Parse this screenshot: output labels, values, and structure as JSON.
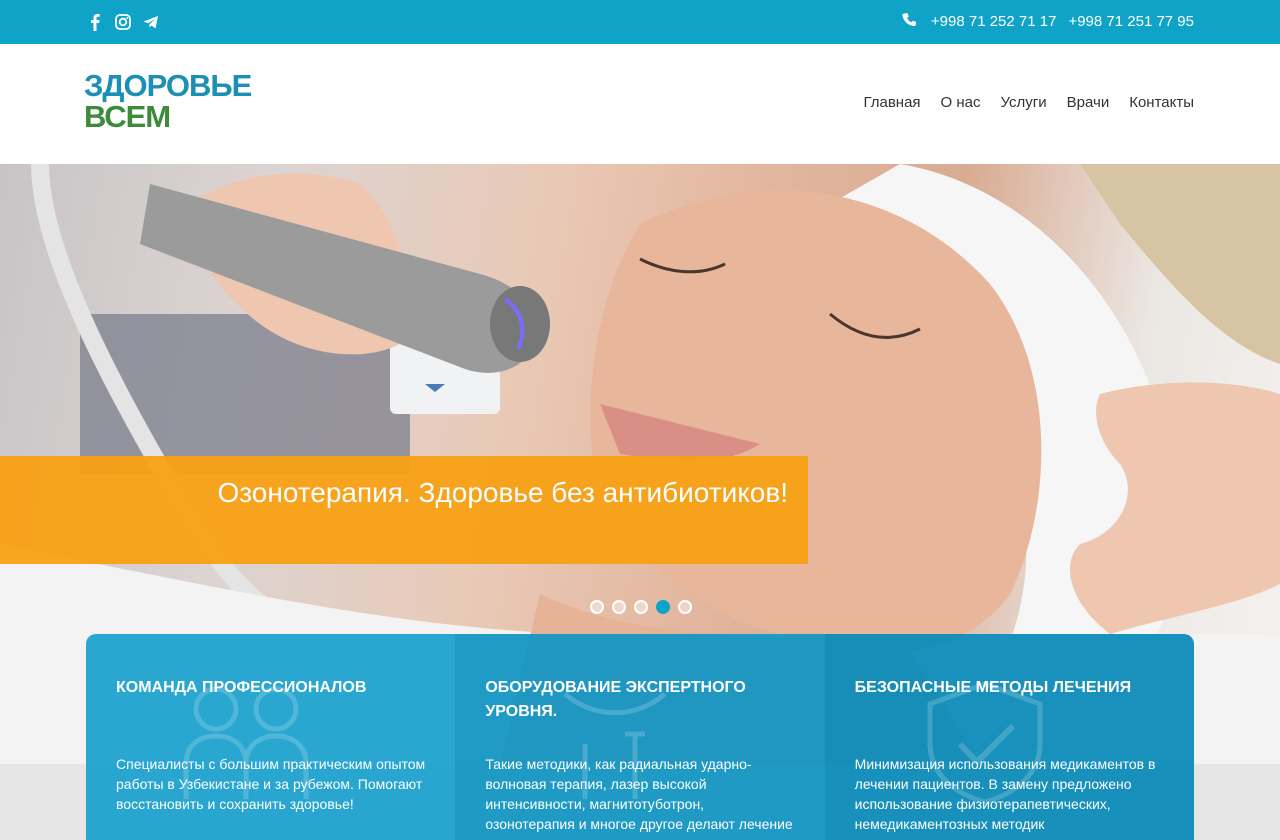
{
  "topbar": {
    "social": [
      {
        "icon": "facebook-icon"
      },
      {
        "icon": "instagram-icon"
      },
      {
        "icon": "telegram-icon"
      }
    ],
    "phone_icon": "phone-icon",
    "phone1": "+998 71 252 71 17",
    "phone2": "+998 71 251 77 95",
    "color": "#0ea3c7"
  },
  "logo": {
    "line1": "ЗДОРОВЬЕ",
    "line2": "ВСЕМ",
    "color1": "#1c90b4",
    "color2": "#3c8b3b"
  },
  "nav": {
    "items": [
      "Главная",
      "О нас",
      "Услуги",
      "Врачи",
      "Контакты"
    ]
  },
  "hero": {
    "banner_text": "Озонотерапия. Здоровье без антибиотиков!",
    "banner_color": "#f8a014",
    "slides_total": 5,
    "active_slide": 4
  },
  "features": [
    {
      "title": "КОМАНДА ПРОФЕССИОНАЛОВ",
      "text": "Специалисты с большим практическим опытом работы в Узбекистане и за рубежом. Помогают восстановить и сохранить здоровье!",
      "icon": "doctors-team-icon"
    },
    {
      "title": "ОБОРУДОВАНИЕ ЭКСПЕРТНОГО УРОВНЯ.",
      "text": "Такие методики, как радиальная ударно-волновая терапия, лазер высокой интенсивности, магнитотуботрон, озонотерапия и многое другое делают лечение",
      "icon": "equipment-icon"
    },
    {
      "title": "БЕЗОПАСНЫЕ МЕТОДЫ ЛЕЧЕНИЯ",
      "text": "Минимизация использования медикаментов в лечении пациентов. В замену предложено использование физиотерапевтических, немедикаментозных методик",
      "icon": "shield-check-icon"
    }
  ]
}
